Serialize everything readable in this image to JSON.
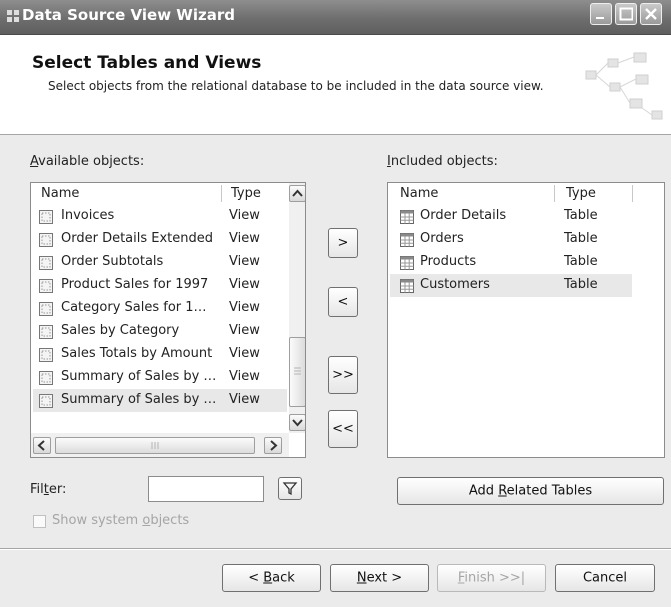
{
  "window": {
    "title": "Data Source View Wizard"
  },
  "header": {
    "title": "Select Tables and Views",
    "subtitle": "Select objects from the relational database to be included in the data source view."
  },
  "available": {
    "label_pre": "",
    "label_key": "A",
    "label_post": "vailable objects:",
    "col_name": "Name",
    "col_type": "Type",
    "rows": [
      {
        "name": "Invoices",
        "type": "View"
      },
      {
        "name": "Order Details Extended",
        "type": "View"
      },
      {
        "name": "Order Subtotals",
        "type": "View"
      },
      {
        "name": "Product Sales for 1997",
        "type": "View"
      },
      {
        "name": "Category Sales for 1…",
        "type": "View"
      },
      {
        "name": "Sales by Category",
        "type": "View"
      },
      {
        "name": "Sales Totals by Amount",
        "type": "View"
      },
      {
        "name": "Summary of Sales by …",
        "type": "View"
      },
      {
        "name": "Summary of Sales by …",
        "type": "View"
      }
    ]
  },
  "included": {
    "label_key": "I",
    "label_post": "ncluded objects:",
    "col_name": "Name",
    "col_type": "Type",
    "rows": [
      {
        "name": "Order Details",
        "type": "Table"
      },
      {
        "name": "Orders",
        "type": "Table"
      },
      {
        "name": "Products",
        "type": "Table"
      },
      {
        "name": "Customers",
        "type": "Table"
      }
    ]
  },
  "move": {
    "add_one": ">",
    "remove_one": "<",
    "add_all": ">>",
    "remove_all": "<<"
  },
  "filter": {
    "label_pre": "Fil",
    "label_key": "t",
    "label_post": "er:",
    "value": ""
  },
  "show_system": {
    "label_pre": "Show system ",
    "label_key": "o",
    "label_post": "bjects",
    "checked": false
  },
  "add_related": {
    "label_pre": "Add ",
    "label_key": "R",
    "label_post": "elated Tables"
  },
  "footer": {
    "back_pre": "< ",
    "back_key": "B",
    "back_post": "ack",
    "next_key": "N",
    "next_post": "ext >",
    "finish_key": "F",
    "finish_post": "inish >>|",
    "cancel": "Cancel"
  },
  "colors": {
    "titlebar": "#6e6e6e",
    "selected_row": "#e8e8e8",
    "window_bg": "#ebebeb"
  },
  "icons": {
    "view_row": "view-icon",
    "table_row": "table-icon",
    "filter": "filter-funnel-icon"
  }
}
